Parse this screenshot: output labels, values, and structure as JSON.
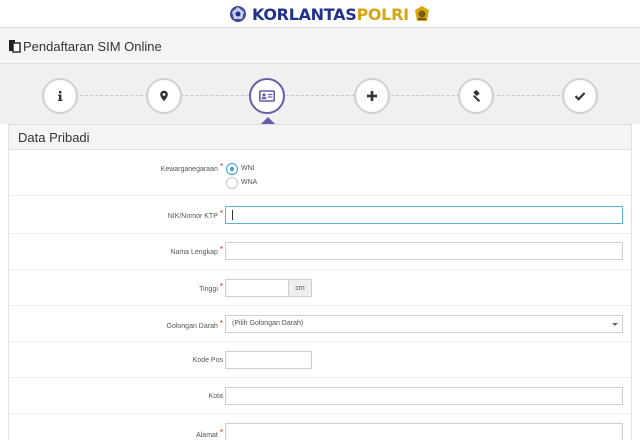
{
  "brand": {
    "name_primary": "KORLANTAS",
    "name_secondary": "POLRI",
    "primary_color": "#22308a",
    "secondary_color": "#d6a514"
  },
  "header": {
    "title": "Pendaftaran SIM Online",
    "icon": "document-icon"
  },
  "steps": [
    {
      "icon": "info-icon",
      "active": false
    },
    {
      "icon": "location-pin-icon",
      "active": false
    },
    {
      "icon": "id-card-icon",
      "active": true
    },
    {
      "icon": "plus-icon",
      "active": false
    },
    {
      "icon": "gavel-icon",
      "active": false
    },
    {
      "icon": "check-icon",
      "active": false
    }
  ],
  "accent_color": "#6b5aa8",
  "form": {
    "section_title": "Data Pribadi",
    "kewarganegaraan": {
      "label": "Kewarganegaraan",
      "options": [
        "WNI",
        "WNA"
      ],
      "selected": "WNI"
    },
    "nik": {
      "label": "NIK/Nomor KTP",
      "value": ""
    },
    "nama": {
      "label": "Nama Lengkap",
      "value": ""
    },
    "tinggi": {
      "label": "Tinggi",
      "value": "",
      "unit": "cm"
    },
    "golongan_darah": {
      "label": "Golongan Darah",
      "selected": "(Pilih Golongan Darah)"
    },
    "kode_pos": {
      "label": "Kode Pos",
      "value": ""
    },
    "kota": {
      "label": "Kota",
      "value": ""
    },
    "alamat": {
      "label": "Alamat",
      "value": ""
    }
  }
}
